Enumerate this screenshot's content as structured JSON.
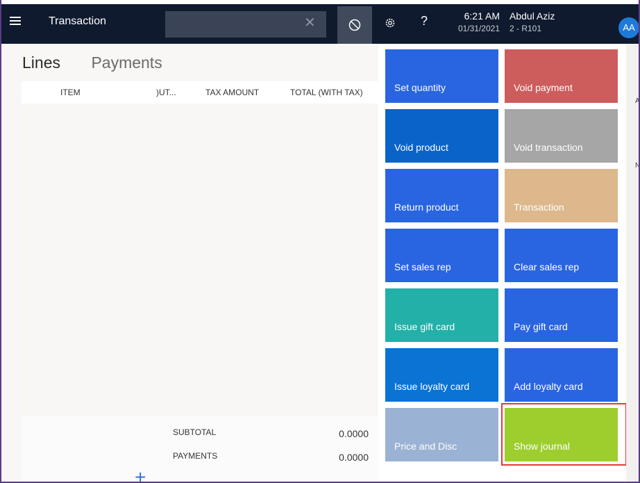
{
  "header": {
    "title": "Transaction",
    "search_value": "",
    "search_placeholder": "",
    "clear_symbol": "✕",
    "help_symbol": "?",
    "time": "6:21 AM",
    "date": "01/31/2021",
    "user_name": "Abdul Aziz",
    "store": "2 - R101",
    "avatar_initials": "AA"
  },
  "left": {
    "tabs": [
      "Lines",
      "Payments"
    ],
    "columns": [
      "ITEM",
      ")UT...",
      "TAX AMOUNT",
      "TOTAL (WITH TAX)"
    ],
    "summary": {
      "subtotal_label": "SUBTOTAL",
      "subtotal_value": "0.0000",
      "payments_label": "PAYMENTS",
      "payments_value": "0.0000"
    },
    "add_symbol": "+"
  },
  "tiles": [
    {
      "label": "Set quantity",
      "color": "#2965e0"
    },
    {
      "label": "Void payment",
      "color": "#cd5d5d"
    },
    {
      "label": "Void product",
      "color": "#0a63c9"
    },
    {
      "label": "Void transaction",
      "color": "#a6a6a6"
    },
    {
      "label": "Return product",
      "color": "#2965e0"
    },
    {
      "label": "Transaction",
      "color": "#dcb88c"
    },
    {
      "label": "Set sales rep",
      "color": "#2965e0"
    },
    {
      "label": "Clear sales rep",
      "color": "#2965e0"
    },
    {
      "label": "Issue gift card",
      "color": "#23b0a8"
    },
    {
      "label": "Pay gift card",
      "color": "#2965e0"
    },
    {
      "label": "Issue loyalty card",
      "color": "#0a73d4"
    },
    {
      "label": "Add loyalty card",
      "color": "#2965e0"
    },
    {
      "label": "Price and Disc",
      "color": "#9ab2d3"
    },
    {
      "label": "Show journal",
      "color": "#9dce2e"
    }
  ],
  "right_strip": {
    "tag_a": "A",
    "tag_n": "N"
  },
  "colors": {
    "topbar": "#0f1a2e",
    "highlight": "#e03b3b",
    "frame": "#5b3a87"
  }
}
